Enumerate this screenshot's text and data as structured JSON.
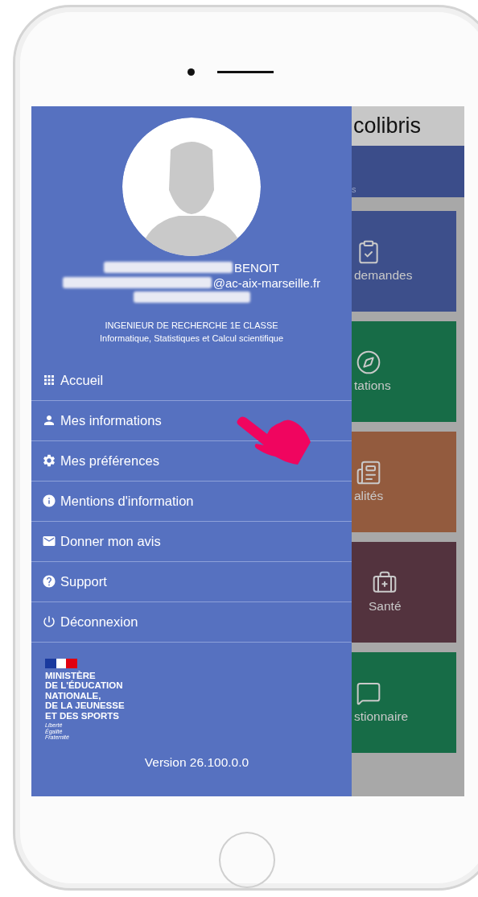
{
  "drawer": {
    "profile": {
      "name": "BENOIT",
      "email": "@ac-aix-marseille.fr",
      "grade": "INGENIEUR DE RECHERCHE 1E CLASSE",
      "specialty": "Informatique, Statistiques et Calcul scientifique"
    },
    "menu": [
      {
        "label": "Accueil",
        "kind": "grid"
      },
      {
        "label": "Mes informations",
        "kind": "person"
      },
      {
        "label": "Mes préférences",
        "kind": "settings"
      },
      {
        "label": "Mentions d'information",
        "kind": "info"
      },
      {
        "label": "Donner mon avis",
        "kind": "mail"
      },
      {
        "label": "Support",
        "kind": "help"
      },
      {
        "label": "Déconnexion",
        "kind": "power"
      }
    ],
    "ministry": {
      "lines": [
        "MINISTÈRE",
        "DE L'ÉDUCATION",
        "NATIONALE,",
        "DE LA JEUNESSE",
        "ET DES SPORTS"
      ],
      "motto": [
        "Liberté",
        "Égalité",
        "Fraternité"
      ]
    },
    "version": "Version 26.100.0.0"
  },
  "background_app": {
    "title": "colibris",
    "banner_text": "s",
    "tiles": [
      {
        "label": "demandes",
        "kind": "requests",
        "color": "#3d4f8b"
      },
      {
        "label": "tations",
        "kind": "compass",
        "color": "#176c47"
      },
      {
        "label": "alités",
        "kind": "news",
        "color": "#935b3e"
      },
      {
        "label": "Santé",
        "kind": "health",
        "color": "#53333e"
      },
      {
        "label": "stionnaire",
        "kind": "chat",
        "color": "#176c47"
      }
    ]
  }
}
